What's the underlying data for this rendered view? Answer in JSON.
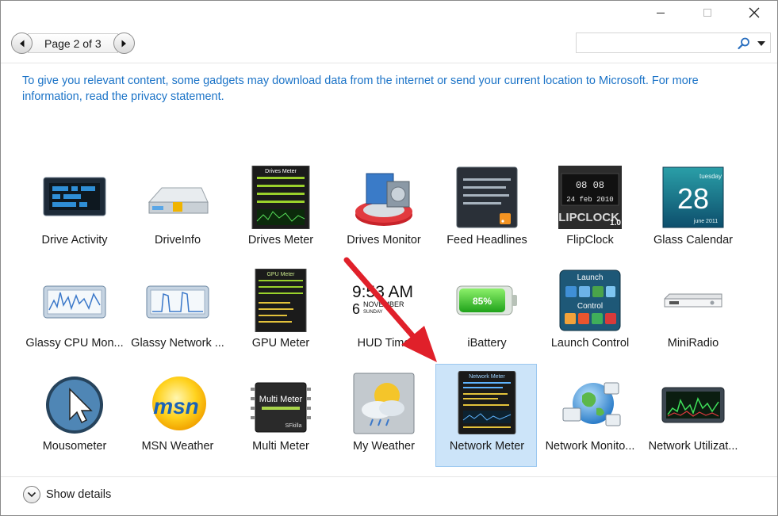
{
  "pager": {
    "label": "Page 2 of 3"
  },
  "search": {
    "value": "",
    "placeholder": ""
  },
  "info_text": "To give you relevant content, some gadgets may download data from the internet or send your current location to Microsoft. For more information, read the privacy statement.",
  "gadgets": [
    {
      "label": "Drive Activity",
      "icon": "drive-activity-icon"
    },
    {
      "label": "DriveInfo",
      "icon": "driveinfo-icon"
    },
    {
      "label": "Drives Meter",
      "icon": "drives-meter-icon"
    },
    {
      "label": "Drives Monitor",
      "icon": "drives-monitor-icon"
    },
    {
      "label": "Feed Headlines",
      "icon": "feed-headlines-icon"
    },
    {
      "label": "FlipClock",
      "icon": "flipclock-icon"
    },
    {
      "label": "Glass Calendar",
      "icon": "glass-calendar-icon"
    },
    {
      "label": "Glassy CPU Mon...",
      "icon": "glassy-cpu-icon"
    },
    {
      "label": "Glassy Network ...",
      "icon": "glassy-network-icon"
    },
    {
      "label": "GPU Meter",
      "icon": "gpu-meter-icon"
    },
    {
      "label": "HUD Time",
      "icon": "hud-time-icon"
    },
    {
      "label": "iBattery",
      "icon": "ibattery-icon"
    },
    {
      "label": "Launch Control",
      "icon": "launch-control-icon"
    },
    {
      "label": "MiniRadio",
      "icon": "miniradio-icon"
    },
    {
      "label": "Mousometer",
      "icon": "mousometer-icon"
    },
    {
      "label": "MSN Weather",
      "icon": "msn-weather-icon"
    },
    {
      "label": "Multi Meter",
      "icon": "multi-meter-icon"
    },
    {
      "label": "My Weather",
      "icon": "my-weather-icon"
    },
    {
      "label": "Network Meter",
      "icon": "network-meter-icon",
      "selected": true
    },
    {
      "label": "Network Monito...",
      "icon": "network-monitor-icon"
    },
    {
      "label": "Network Utilizat...",
      "icon": "network-utilization-icon"
    }
  ],
  "thumb_text": {
    "drives_meter_title": "Drives Meter",
    "flipclock_word": "FLIPCLOCK",
    "flipclock_version": "1.0",
    "flipclock_top": "08 08",
    "flipclock_bottom": "24 feb 2010",
    "calendar_day": "tuesday",
    "calendar_date": "28",
    "calendar_month": "june 2011",
    "gpu_title": "GPU Meter",
    "hud_time": "9:53 AM",
    "hud_day": "6",
    "hud_month": "NOVEMBER",
    "hud_weekday": "SUNDAY",
    "battery_percent": "85%",
    "launch_title": "Launch",
    "launch_control": "Control",
    "msn_text": "msn",
    "multi_meter_text": "Multi Meter",
    "multi_meter_sig": "SFkilla",
    "network_meter_title": "Network Meter"
  },
  "details": {
    "label": "Show details"
  },
  "colors": {
    "link": "#1b73c7",
    "selected_bg": "#cce4f9",
    "selected_border": "#9bc8f0",
    "arrow": "#e0202a"
  }
}
